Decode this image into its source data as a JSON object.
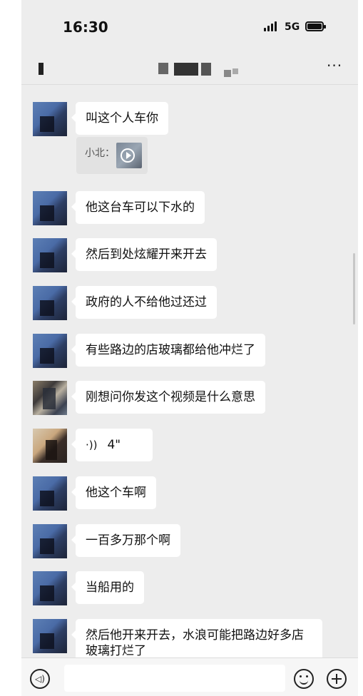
{
  "status_bar": {
    "time": "16:30",
    "network": "5G"
  },
  "header": {
    "more_icon": "more-dots-icon",
    "more_label": "···"
  },
  "quote": {
    "label": "小北：",
    "thumb_icon": "video-play-icon"
  },
  "messages": [
    {
      "text": "叫这个人车你"
    },
    {
      "text": "他这台车可以下水的"
    },
    {
      "text": "然后到处炫耀开来开去"
    },
    {
      "text": "政府的人不给他过还过"
    },
    {
      "text": "有些路边的店玻璃都给他冲烂了"
    },
    {
      "text": "刚想问你发这个视频是什么意思"
    },
    {
      "text": "4\"",
      "voice_icon": "voice-wave-icon",
      "voice_glyph": "·))"
    },
    {
      "text": "他这个车啊"
    },
    {
      "text": "一百多万那个啊"
    },
    {
      "text": "当船用的"
    },
    {
      "text": "然后他开来开去，水浪可能把路边好多店玻璃打烂了"
    }
  ],
  "input_bar": {
    "voice_icon": "voice-mode-icon",
    "emoji_icon": "emoji-icon",
    "plus_icon": "add-more-icon"
  }
}
